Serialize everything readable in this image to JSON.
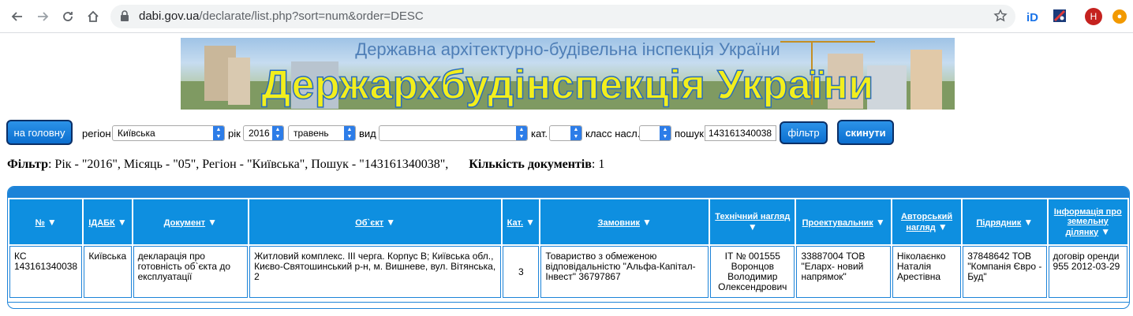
{
  "browser": {
    "url_host": "dabi.gov.ua",
    "url_path": "/declarate/list.php?sort=num&order=DESC",
    "avatar_letter": "H"
  },
  "banner": {
    "subtitle": "Державна архітектурно-будівельна інспекція України",
    "title": "Держархбудінспекція України"
  },
  "filters": {
    "home_button": "на головну",
    "region_label": "регіон",
    "region_value": "Київська",
    "year_label": "рік",
    "year_value": "2016",
    "month_value": "травень",
    "type_label": "вид",
    "type_value": "",
    "category_label": "кат.",
    "category_value": "",
    "class_label": "класс насл.",
    "class_value": "",
    "search_label": "пошук",
    "search_value": "143161340038",
    "filter_button": "фільтр",
    "reset_button": "скинути"
  },
  "summary": {
    "filter_label": "Фільтр",
    "filter_text": ": Рік - \"2016\", Місяць - \"05\", Регіон - \"Київська\", Пошук - \"143161340038\",",
    "count_label": "Кількість документів",
    "count_text": ": 1"
  },
  "table": {
    "headers": [
      "№",
      "ІДАБК",
      "Документ",
      "Об`єкт",
      "Кат.",
      "Замовник",
      "Технічний нагляд",
      "Проектувальник",
      "Авторський нагляд",
      "Підрядник",
      "Інформація про земельну ділянку"
    ],
    "rows": [
      [
        "КС 143161340038",
        "Київська",
        "декларація про готовність об`єкта до експлуатації",
        "Житловий комплекс. ІІІ черга. Корпус В; Київська обл., Києво-Святошинський р-н, м. Вишневе, вул. Вітянська, 2",
        "3",
        "Товариство з обмеженою відповідальністю \"Альфа-Капітал-Інвест\" 36797867",
        "ІТ № 001555 Воронцов Володимир Олексендрович",
        "33887004 ТОВ \"Еларх- новий напрямок\"",
        "Ніколаєнко Наталія Арестівна",
        "37848642 ТОВ \"Компанія Єврo - Буд\"",
        "договір оренди 955 2012-03-29"
      ]
    ]
  },
  "colors": {
    "accent_blue": "#1c83d8",
    "header_blue": "#0e8fe0",
    "banner_yellow": "#f2ee1d"
  }
}
